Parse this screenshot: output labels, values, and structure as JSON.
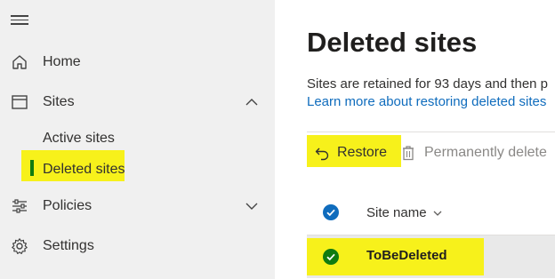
{
  "nav": {
    "menu_icon": "hamburger-icon",
    "items": [
      {
        "label": "Home",
        "icon": "home-icon"
      },
      {
        "label": "Sites",
        "icon": "window-icon",
        "expanded": true
      },
      {
        "label": "Policies",
        "icon": "sliders-icon",
        "expanded": false
      },
      {
        "label": "Settings",
        "icon": "gear-icon"
      }
    ],
    "sites_children": [
      {
        "label": "Active sites"
      },
      {
        "label": "Deleted sites",
        "selected": true
      }
    ]
  },
  "page": {
    "title": "Deleted sites",
    "description": "Sites are retained for 93 days and then p",
    "learn_more": "Learn more about restoring deleted sites"
  },
  "toolbar": {
    "restore_label": "Restore",
    "restore_icon": "undo-icon",
    "delete_label": "Permanently delete",
    "delete_icon": "trash-icon"
  },
  "table": {
    "column_header": "Site name",
    "rows": [
      {
        "name": "ToBeDeleted",
        "selected": true
      }
    ]
  },
  "colors": {
    "accent": "#0f6cbd",
    "selected_check": "#107c10",
    "highlight": "#f7f11b"
  }
}
